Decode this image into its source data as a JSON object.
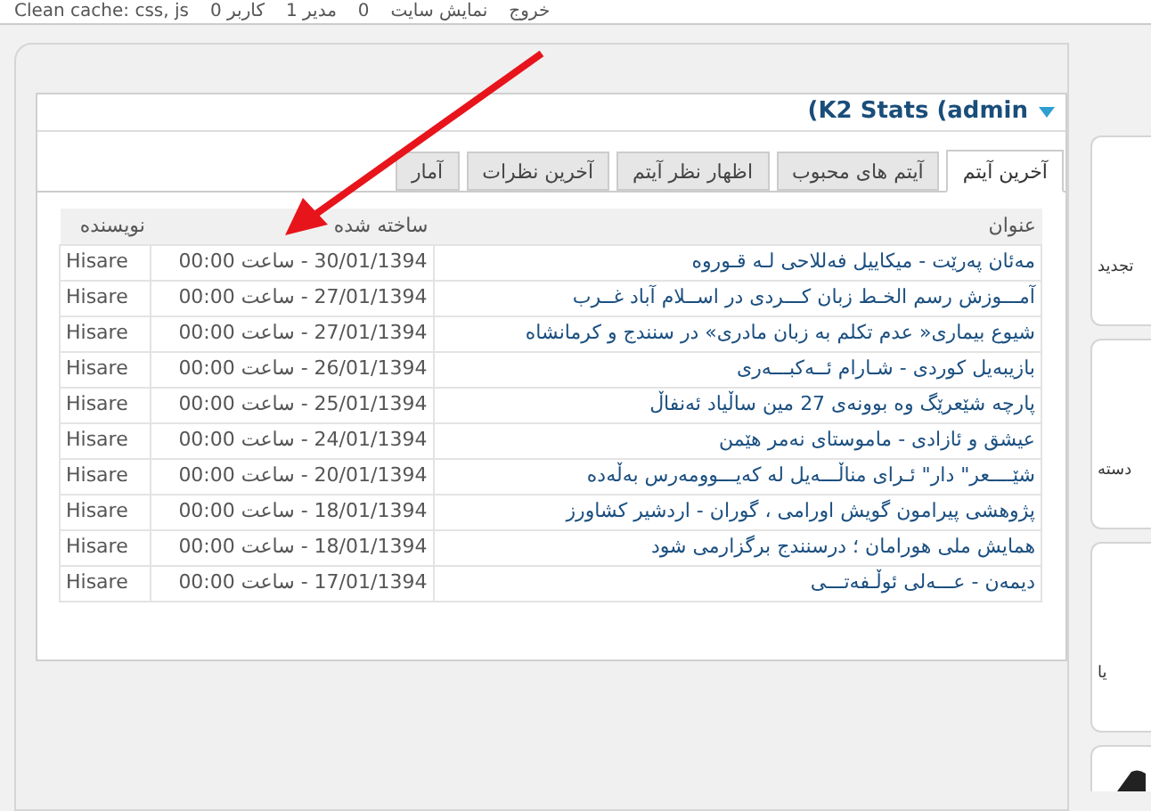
{
  "top_bar": {
    "items": [
      "خروج",
      "نمایش سایت",
      "0",
      "1 مدیر",
      "0 کاربر",
      "Clean cache: css, js"
    ]
  },
  "module": {
    "title": "(K2 Stats (admin",
    "tabs": [
      {
        "label": "آخرین آیتم",
        "selected": true
      },
      {
        "label": "آیتم های محبوب",
        "selected": false
      },
      {
        "label": "اظهار نظر آیتم",
        "selected": false
      },
      {
        "label": "آخرین نظرات",
        "selected": false
      },
      {
        "label": "آمار",
        "selected": false
      }
    ],
    "table": {
      "columns": [
        "عنوان",
        "ساخته شده",
        "نویسنده"
      ],
      "rows": [
        [
          "مه‌ئان په‌رێت - میکاییل فه‌للاحی لـه قـوروه",
          "30/01/1394 - ساعت 00:00",
          "Hisare"
        ],
        [
          "آمـــوزش رسم الخـط زبان کـــردی در اســلام آباد غــرب",
          "27/01/1394 - ساعت 00:00",
          "Hisare"
        ],
        [
          "شیوع بیماری« عدم تکلم به زبان مادری» در سنندج و کرمانشاه",
          "27/01/1394 - ساعت 00:00",
          "Hisare"
        ],
        [
          "بازیبه‌یل کوردی - شـارام ئــه‌کبـــه‌ری",
          "26/01/1394 - ساعت 00:00",
          "Hisare"
        ],
        [
          "پارچه شێعرێگ وه بوونه‌ی 27 مین ساڵیاد ئه‌نفاڵ",
          "25/01/1394 - ساعت 00:00",
          "Hisare"
        ],
        [
          "عیشق و ئازادی - ماموستای نه‌مر هێمن",
          "24/01/1394 - ساعت 00:00",
          "Hisare"
        ],
        [
          "شێــــعر\" دار\" ئـرای مناڵـــه‌یل له که‌یـــوومه‌رس به‌ڵه‌ده",
          "20/01/1394 - ساعت 00:00",
          "Hisare"
        ],
        [
          "پژوهشی پیرامون گویش اورامی ، گوران - اردشیر کشاورز",
          "18/01/1394 - ساعت 00:00",
          "Hisare"
        ],
        [
          "همایش ملی هورامان ؛ درسنندج برگزارمی شود",
          "18/01/1394 - ساعت 00:00",
          "Hisare"
        ],
        [
          "دیمه‌ن - عـــه‌لی ئوڵـفه‌تـــی",
          "17/01/1394 - ساعت 00:00",
          "Hisare"
        ]
      ]
    }
  },
  "side_cards": [
    {
      "kind": "label",
      "label": "تجدید"
    },
    {
      "kind": "label",
      "label": "دسته"
    },
    {
      "kind": "label",
      "label": "یا"
    },
    {
      "kind": "icon"
    }
  ]
}
